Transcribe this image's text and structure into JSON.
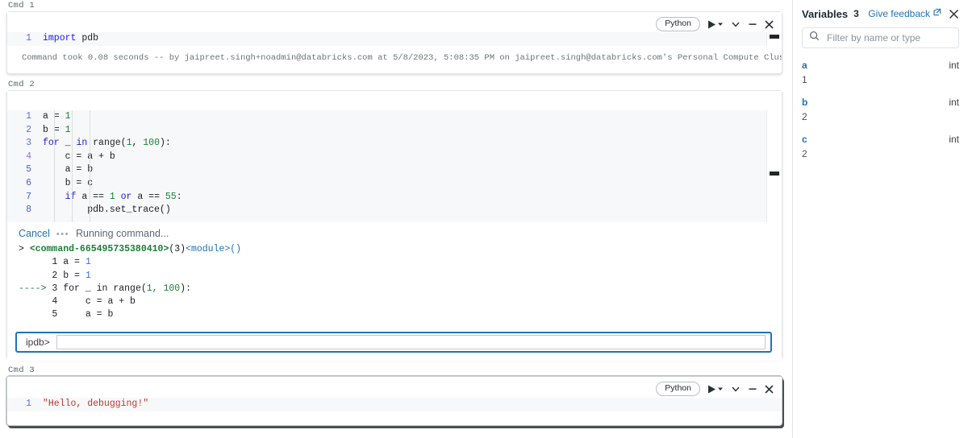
{
  "notebook": {
    "cells": [
      {
        "label": "Cmd 1",
        "language": "Python",
        "selected": false,
        "lines": [
          {
            "n": "1",
            "tokens": [
              {
                "t": "import",
                "c": "kw"
              },
              {
                "t": " pdb",
                "c": "code-txt"
              }
            ]
          }
        ],
        "footer": "Command took 0.08 seconds -- by jaipreet.singh+noadmin@databricks.com at 5/8/2023, 5:08:35 PM on jaipreet.singh@databricks.com's Personal Compute Cluster"
      },
      {
        "label": "Cmd 2",
        "language": "Python",
        "selected": false,
        "lines": [
          {
            "n": "1",
            "tokens": [
              {
                "t": "a = ",
                "c": "code-txt"
              },
              {
                "t": "1",
                "c": "num"
              }
            ]
          },
          {
            "n": "2",
            "tokens": [
              {
                "t": "b = ",
                "c": "code-txt"
              },
              {
                "t": "1",
                "c": "num"
              }
            ]
          },
          {
            "n": "3",
            "tokens": [
              {
                "t": "for",
                "c": "kw"
              },
              {
                "t": " _ ",
                "c": "code-txt"
              },
              {
                "t": "in",
                "c": "kw"
              },
              {
                "t": " range(",
                "c": "code-txt"
              },
              {
                "t": "1",
                "c": "num"
              },
              {
                "t": ", ",
                "c": "code-txt"
              },
              {
                "t": "100",
                "c": "num"
              },
              {
                "t": "):",
                "c": "code-txt"
              }
            ]
          },
          {
            "n": "4",
            "tokens": [
              {
                "t": "    c = a + b",
                "c": "code-txt"
              }
            ]
          },
          {
            "n": "5",
            "tokens": [
              {
                "t": "    a = b",
                "c": "code-txt"
              }
            ]
          },
          {
            "n": "6",
            "tokens": [
              {
                "t": "    b = c",
                "c": "code-txt"
              }
            ]
          },
          {
            "n": "7",
            "tokens": [
              {
                "t": "    ",
                "c": "code-txt"
              },
              {
                "t": "if",
                "c": "kw"
              },
              {
                "t": " a == ",
                "c": "code-txt"
              },
              {
                "t": "1",
                "c": "num"
              },
              {
                "t": " ",
                "c": "code-txt"
              },
              {
                "t": "or",
                "c": "kw"
              },
              {
                "t": " a == ",
                "c": "code-txt"
              },
              {
                "t": "55",
                "c": "num"
              },
              {
                "t": ":",
                "c": "code-txt"
              }
            ]
          },
          {
            "n": "8",
            "tokens": [
              {
                "t": "        pdb.set_trace()",
                "c": "code-txt"
              }
            ]
          }
        ]
      },
      {
        "label": "Cmd 3",
        "language": "Python",
        "selected": true,
        "lines": [
          {
            "n": "1",
            "tokens": [
              {
                "t": "\"Hello, debugging!\"",
                "c": "str"
              }
            ]
          }
        ]
      }
    ],
    "toolbar": {
      "run_icon": "play-icon",
      "run_caret_icon": "caret-down-icon",
      "chevron_icon": "chevron-down-icon",
      "minimize_icon": "minus-icon",
      "close_icon": "close-icon"
    },
    "debug": {
      "cancel_label": "Cancel",
      "dots": "•••",
      "status": "Running command...",
      "prompt_line": {
        "marker": "> ",
        "command_id": "<command-665495735380410>",
        "frame": "(3)",
        "module": "<module>",
        "parens": "()"
      },
      "trace_lines": [
        {
          "arrow": "",
          "n": "1",
          "code_pre": " a = ",
          "code_num": "1",
          "code_post": ""
        },
        {
          "arrow": "",
          "n": "2",
          "code_pre": " b = ",
          "code_num": "1",
          "code_post": ""
        },
        {
          "arrow": "---->",
          "n": "3",
          "code_pre": " for _ in range(",
          "code_num": "1, 100",
          "code_post": "):"
        },
        {
          "arrow": "",
          "n": "4",
          "code_pre": "     c = a + b",
          "code_num": "",
          "code_post": ""
        },
        {
          "arrow": "",
          "n": "5",
          "code_pre": "     a = b",
          "code_num": "",
          "code_post": ""
        }
      ],
      "input": {
        "label": "ipdb>",
        "value": "",
        "placeholder": ""
      }
    }
  },
  "variables": {
    "title": "Variables",
    "count": "3",
    "feedback_label": "Give feedback",
    "feedback_icon": "external-link-icon",
    "close_icon": "close-icon",
    "search": {
      "icon": "search-icon",
      "placeholder": "Filter by name or type",
      "value": ""
    },
    "items": [
      {
        "name": "a",
        "type": "int",
        "value": "1"
      },
      {
        "name": "b",
        "type": "int",
        "value": "2"
      },
      {
        "name": "c",
        "type": "int",
        "value": "2"
      }
    ]
  },
  "colors": {
    "accent": "#2272b4",
    "keyword": "#1a1ae6",
    "number": "#1a7f37",
    "string": "#c0392b",
    "linenumber": "#5472e4"
  }
}
